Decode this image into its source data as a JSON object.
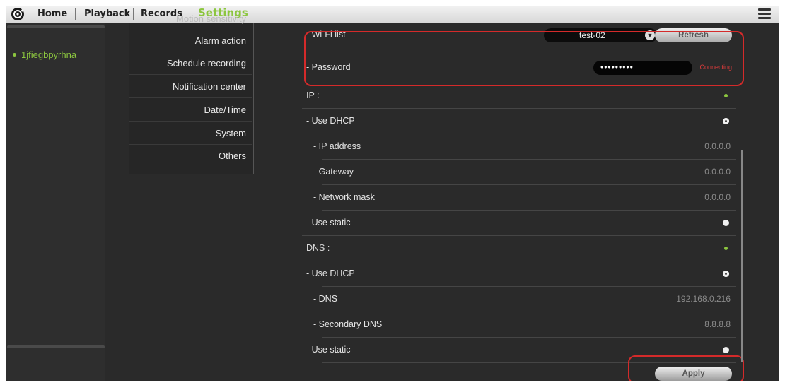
{
  "nav": {
    "home": "Home",
    "playback": "Playback",
    "records": "Records",
    "settings": "Settings"
  },
  "devices": [
    "1jfiegbpyrhna"
  ],
  "menu": [
    "Motion sensitivity",
    "Alarm action",
    "Schedule recording",
    "Notification center",
    "Date/Time",
    "System",
    "Others"
  ],
  "wifi": {
    "list_label": "- Wi-Fi list",
    "selected_ssid": "test-02",
    "refresh_label": "Refresh",
    "password_label": "- Password",
    "password_value": "•••••••••",
    "status": "Connecting"
  },
  "ip": {
    "section_label": "IP :",
    "dhcp_label": "- Use DHCP",
    "address_label": "- IP address",
    "address_value": "0.0.0.0",
    "gateway_label": "- Gateway",
    "gateway_value": "0.0.0.0",
    "mask_label": "- Network mask",
    "mask_value": "0.0.0.0",
    "static_label": "- Use static"
  },
  "dns": {
    "section_label": "DNS :",
    "dhcp_label": "- Use DHCP",
    "primary_label": "- DNS",
    "primary_value": "192.168.0.216",
    "secondary_label": "- Secondary DNS",
    "secondary_value": "8.8.8.8",
    "static_label": "- Use static"
  },
  "apply_label": "Apply",
  "colors": {
    "accent": "#8cc63f",
    "highlight": "#d42a2a",
    "background": "#2a2a2a",
    "status_error": "#e03c3c"
  }
}
